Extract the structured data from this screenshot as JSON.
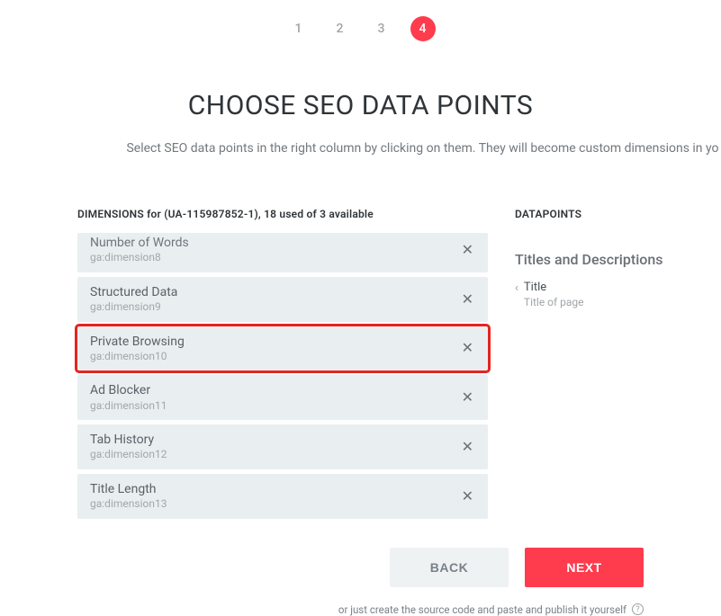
{
  "stepper": {
    "steps": [
      "1",
      "2",
      "3",
      "4"
    ],
    "active_index": 3
  },
  "title": "CHOOSE SEO DATA POINTS",
  "subtitle": "Select SEO data points in the right column by clicking on them. They will become custom dimensions in yo",
  "dimensions": {
    "heading": "DIMENSIONS for (UA-115987852-1), 18 used of 3 available",
    "items": [
      {
        "label": "Number of Words",
        "sub": "ga:dimension8",
        "truncated_top": true,
        "highlight": false
      },
      {
        "label": "Structured Data",
        "sub": "ga:dimension9",
        "truncated_top": false,
        "highlight": false
      },
      {
        "label": "Private Browsing",
        "sub": "ga:dimension10",
        "truncated_top": false,
        "highlight": true
      },
      {
        "label": "Ad Blocker",
        "sub": "ga:dimension11",
        "truncated_top": false,
        "highlight": false
      },
      {
        "label": "Tab History",
        "sub": "ga:dimension12",
        "truncated_top": false,
        "highlight": false
      },
      {
        "label": "Title Length",
        "sub": "ga:dimension13",
        "truncated_top": false,
        "highlight": false
      }
    ]
  },
  "datapoints": {
    "heading": "DATAPOINTS",
    "section_title": "Titles and Descriptions",
    "items": [
      {
        "label": "Title",
        "sub": "Title of page"
      }
    ]
  },
  "buttons": {
    "back": "BACK",
    "next": "NEXT"
  },
  "footer": {
    "note": "or just create the source code and paste and publish it yourself",
    "help_glyph": "?"
  }
}
